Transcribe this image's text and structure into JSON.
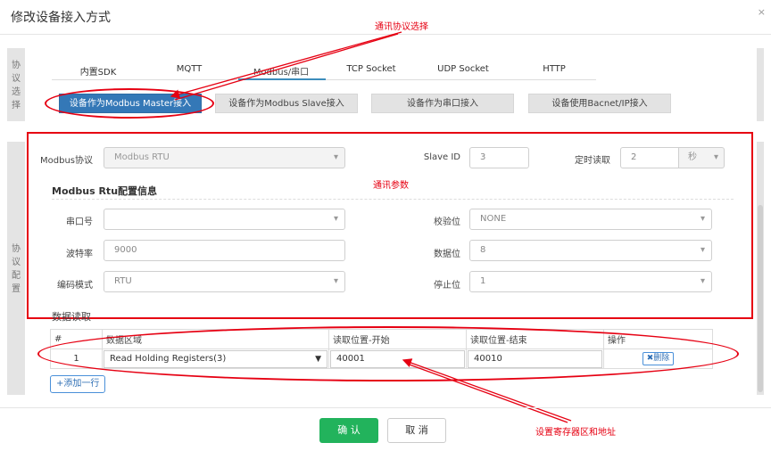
{
  "dialog": {
    "title": "修改设备接入方式",
    "close": "×"
  },
  "sections": {
    "protocol_select": "协\n议\n选\n择",
    "protocol_config": "协\n议\n配\n置"
  },
  "tabs": [
    {
      "label": "内置SDK",
      "active": false
    },
    {
      "label": "MQTT",
      "active": false
    },
    {
      "label": "Modbus/串口",
      "active": true
    },
    {
      "label": "TCP Socket",
      "active": false
    },
    {
      "label": "UDP Socket",
      "active": false
    },
    {
      "label": "HTTP",
      "active": false
    }
  ],
  "modes": [
    {
      "label": "设备作为Modbus Master接入",
      "active": true
    },
    {
      "label": "设备作为Modbus Slave接入",
      "active": false
    },
    {
      "label": "设备作为串口接入",
      "active": false
    },
    {
      "label": "设备使用Bacnet/IP接入",
      "active": false
    }
  ],
  "annotations": {
    "protocol_choice": "通讯协议选择",
    "params": "通讯参数",
    "registers": "设置寄存器区和地址",
    "color": "#e60012"
  },
  "form": {
    "modbus_protocol": {
      "label": "Modbus协议",
      "value": "Modbus RTU"
    },
    "slave_id": {
      "label": "Slave ID",
      "value": "3"
    },
    "timed_read": {
      "label": "定时读取",
      "value": "2",
      "unit": "秒"
    },
    "rtu_section_title": "Modbus Rtu配置信息",
    "serial_port": {
      "label": "串口号",
      "value": ""
    },
    "parity": {
      "label": "校验位",
      "value": "NONE"
    },
    "baud_rate": {
      "label": "波特率",
      "value": "9000"
    },
    "data_bits": {
      "label": "数据位",
      "value": "8"
    },
    "encoding_mode": {
      "label": "编码模式",
      "value": "RTU"
    },
    "stop_bits": {
      "label": "停止位",
      "value": "1"
    }
  },
  "data_read": {
    "title": "数据读取",
    "headers": [
      "#",
      "数据区域",
      "读取位置-开始",
      "读取位置-结束",
      "操作"
    ],
    "rows": [
      {
        "index": "1",
        "area": "Read Holding Registers(3)",
        "start": "40001",
        "end": "40010",
        "action": "删除"
      }
    ],
    "add_row": "添加一行"
  },
  "footer": {
    "confirm": "确 认",
    "cancel": "取 消"
  },
  "colors": {
    "primary": "#3478b7",
    "confirm": "#22b35c",
    "annotation": "#e60012"
  }
}
